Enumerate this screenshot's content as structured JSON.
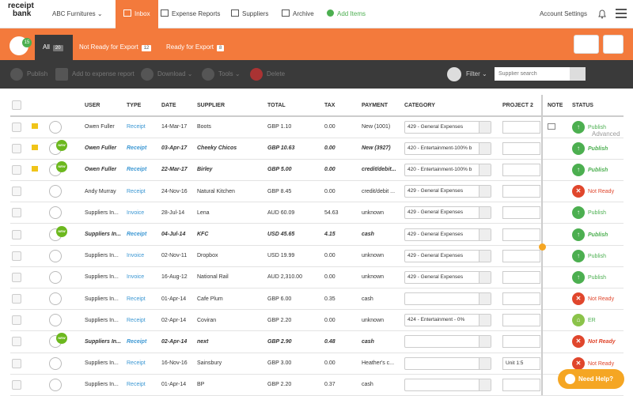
{
  "logo": {
    "line1": "receipt",
    "line2": "bank"
  },
  "nav": {
    "company": "ABC Furnitures",
    "inbox": "Inbox",
    "expense_reports": "Expense Reports",
    "suppliers": "Suppliers",
    "archive": "Archive",
    "add_items": "Add Items",
    "account_settings": "Account Settings"
  },
  "tabs": {
    "inbox_badge": "15",
    "all": "All",
    "all_count": "20",
    "not_ready": "Not Ready for Export",
    "not_ready_count": "12",
    "ready": "Ready for Export",
    "ready_count": "8"
  },
  "toolbar": {
    "publish": "Publish",
    "add_to_report": "Add to expense report",
    "download": "Download",
    "tools": "Tools",
    "delete": "Delete",
    "filter": "Filter",
    "search_placeholder": "Supplier search",
    "advanced": "Advanced"
  },
  "columns": {
    "user": "USER",
    "type": "TYPE",
    "date": "DATE",
    "supplier": "SUPPLIER",
    "total": "TOTAL",
    "tax": "TAX",
    "payment": "PAYMENT",
    "category": "CATEGORY",
    "project": "PROJECT 2",
    "note": "NOTE",
    "status": "STATUS"
  },
  "rows": [
    {
      "user": "Owen Fuller",
      "type": "Receipt",
      "date": "14-Mar-17",
      "supplier": "Boots",
      "total": "GBP 1.10",
      "tax": "0.00",
      "payment": "New (1001)",
      "category": "429 - General Expenses",
      "project": "",
      "status": "Publish"
    },
    {
      "user": "Owen Fuller",
      "type": "Receipt",
      "date": "03-Apr-17",
      "supplier": "Cheeky Chicos",
      "total": "GBP 10.63",
      "tax": "0.00",
      "payment": "New (3927)",
      "category": "420 - Entertainment-100% b",
      "project": "",
      "status": "Publish"
    },
    {
      "user": "Owen Fuller",
      "type": "Receipt",
      "date": "22-Mar-17",
      "supplier": "Birley",
      "total": "GBP 5.00",
      "tax": "0.00",
      "payment": "credit/debit...",
      "category": "420 - Entertainment-100% b",
      "project": "",
      "status": "Publish"
    },
    {
      "user": "Andy Murray",
      "type": "Receipt",
      "date": "24-Nov-16",
      "supplier": "Natural Kitchen",
      "total": "GBP 8.45",
      "tax": "0.00",
      "payment": "credit/debit ...",
      "category": "429 - General Expenses",
      "project": "",
      "status": "Not Ready"
    },
    {
      "user": "Suppliers In...",
      "type": "Invoice",
      "date": "28-Jul-14",
      "supplier": "Lena",
      "total": "AUD 60.09",
      "tax": "54.63",
      "payment": "unknown",
      "category": "429 - General Expenses",
      "project": "",
      "status": "Publish"
    },
    {
      "user": "Suppliers In...",
      "type": "Receipt",
      "date": "04-Jul-14",
      "supplier": "KFC",
      "total": "USD 45.65",
      "tax": "4.15",
      "payment": "cash",
      "category": "429 - General Expenses",
      "project": "",
      "status": "Publish"
    },
    {
      "user": "Suppliers In...",
      "type": "Invoice",
      "date": "02-Nov-11",
      "supplier": "Dropbox",
      "total": "USD 19.99",
      "tax": "0.00",
      "payment": "unknown",
      "category": "429 - General Expenses",
      "project": "",
      "status": "Publish"
    },
    {
      "user": "Suppliers In...",
      "type": "Invoice",
      "date": "16-Aug-12",
      "supplier": "National Rail",
      "total": "AUD 2,310.00",
      "tax": "0.00",
      "payment": "unknown",
      "category": "429 - General Expenses",
      "project": "",
      "status": "Publish"
    },
    {
      "user": "Suppliers In...",
      "type": "Receipt",
      "date": "01-Apr-14",
      "supplier": "Cafe Plum",
      "total": "GBP 6.00",
      "tax": "0.35",
      "payment": "cash",
      "category": "",
      "project": "",
      "status": "Not Ready"
    },
    {
      "user": "Suppliers In...",
      "type": "Receipt",
      "date": "02-Apr-14",
      "supplier": "Coviran",
      "total": "GBP 2.20",
      "tax": "0.00",
      "payment": "unknown",
      "category": "424 - Entertainment - 0%",
      "project": "",
      "status": "ER"
    },
    {
      "user": "Suppliers In...",
      "type": "Receipt",
      "date": "02-Apr-14",
      "supplier": "next",
      "total": "GBP 2.90",
      "tax": "0.48",
      "payment": "cash",
      "category": "",
      "project": "",
      "status": "Not Ready"
    },
    {
      "user": "Suppliers In...",
      "type": "Receipt",
      "date": "16-Nov-16",
      "supplier": "Sainsbury",
      "total": "GBP 3.00",
      "tax": "0.00",
      "payment": "Heather's c...",
      "category": "",
      "project": "Unit 1:5",
      "status": "Not Ready"
    },
    {
      "user": "Suppliers In...",
      "type": "Receipt",
      "date": "01-Apr-14",
      "supplier": "BP",
      "total": "GBP 2.20",
      "tax": "0.37",
      "payment": "cash",
      "category": "",
      "project": "",
      "status": ""
    }
  ],
  "help": "Need Help?"
}
